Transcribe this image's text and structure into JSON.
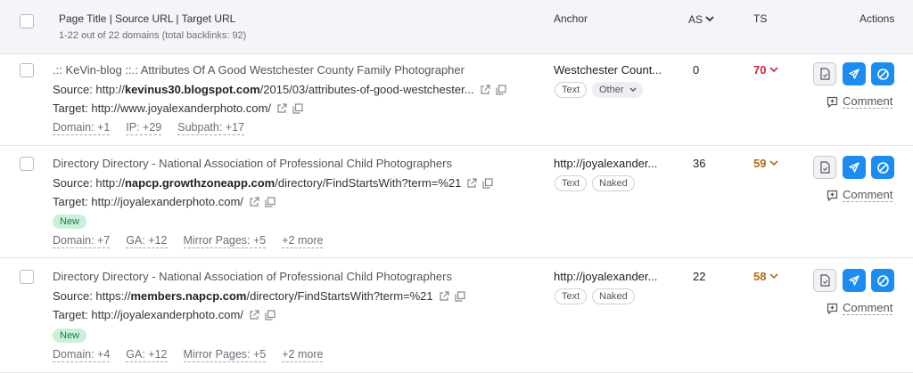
{
  "header": {
    "title": "Page Title | Source URL | Target URL",
    "subtitle": "1-22 out of 22 domains (total backlinks: 92)",
    "anchor": "Anchor",
    "as": "AS",
    "ts": "TS",
    "actions": "Actions"
  },
  "colors": {
    "ts_red": "#d1263a",
    "ts_orange": "#b06a12",
    "action_blue": "#1d8cf0",
    "new_badge_bg": "#c9f0d8"
  },
  "rows": [
    {
      "title": ".:: KeVin-blog ::.: Attributes Of A Good Westchester County Family Photographer",
      "source_prefix": "Source: http://",
      "source_domain": "kevinus30.blogspot.com",
      "source_path": "/2015/03/attributes-of-good-westchester...",
      "target": "Target: http://www.joyalexanderphoto.com/",
      "new_label": "",
      "meta": [
        "Domain: +1",
        "IP: +29",
        "Subpath: +17"
      ],
      "anchor": "Westchester Count...",
      "tags": [
        "Text",
        "Other"
      ],
      "as": "0",
      "ts": "70",
      "comment": "Comment"
    },
    {
      "title": "Directory Directory - National Association of Professional Child Photographers",
      "source_prefix": "Source: http://",
      "source_domain": "napcp.growthzoneapp.com",
      "source_path": "/directory/FindStartsWith?term=%21",
      "target": "Target: http://joyalexanderphoto.com/",
      "new_label": "New",
      "meta": [
        "Domain: +7",
        "GA: +12",
        "Mirror Pages: +5",
        "+2 more"
      ],
      "anchor": "http://joyalexander...",
      "tags": [
        "Text",
        "Naked"
      ],
      "as": "36",
      "ts": "59",
      "comment": "Comment"
    },
    {
      "title": "Directory Directory - National Association of Professional Child Photographers",
      "source_prefix": "Source: https://",
      "source_domain": "members.napcp.com",
      "source_path": "/directory/FindStartsWith?term=%21",
      "target": "Target: http://joyalexanderphoto.com/",
      "new_label": "New",
      "meta": [
        "Domain: +4",
        "GA: +12",
        "Mirror Pages: +5",
        "+2 more"
      ],
      "anchor": "http://joyalexander...",
      "tags": [
        "Text",
        "Naked"
      ],
      "as": "22",
      "ts": "58",
      "comment": "Comment"
    }
  ]
}
